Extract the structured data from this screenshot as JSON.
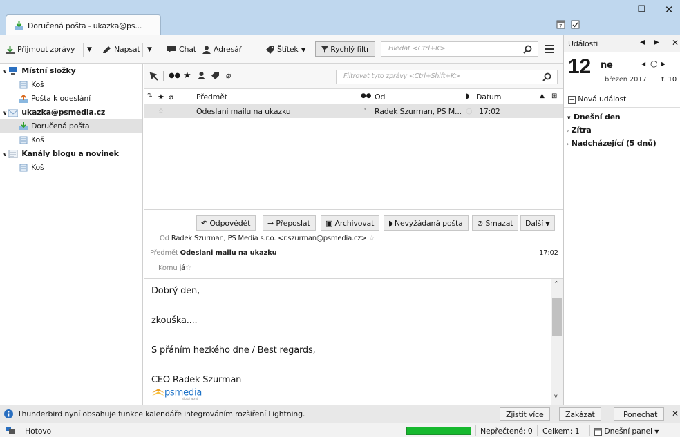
{
  "tab": {
    "title": "Doručená pošta - ukazka@ps..."
  },
  "toolbar": {
    "get_mail": "Přijmout zprávy",
    "write": "Napsat",
    "chat": "Chat",
    "address_book": "Adresář",
    "tag": "Štítek",
    "quick_filter": "Rychlý filtr",
    "search_placeholder": "Hledat <Ctrl+K>"
  },
  "folders": [
    {
      "label": "Místní složky",
      "bold": true
    },
    {
      "label": "Koš"
    },
    {
      "label": "Pošta k odeslání"
    },
    {
      "label": "ukazka@psmedia.cz",
      "bold": true
    },
    {
      "label": "Doručená pošta",
      "selected": true
    },
    {
      "label": "Koš"
    },
    {
      "label": "Kanály blogu a novinek",
      "bold": true
    },
    {
      "label": "Koš"
    }
  ],
  "thread": {
    "filter_placeholder": "Filtrovat tyto zprávy <Ctrl+Shift+K>",
    "columns": {
      "subject": "Předmět",
      "from": "Od",
      "date": "Datum"
    },
    "row": {
      "subject": "Odeslani mailu na ukazku",
      "from": "Radek Szurman, PS M...",
      "date": "17:02"
    }
  },
  "actions": {
    "reply": "Odpovědět",
    "forward": "Přeposlat",
    "archive": "Archivovat",
    "junk": "Nevyžádaná pošta",
    "delete": "Smazat",
    "more": "Další"
  },
  "header": {
    "from_label": "Od",
    "from_value": "Radek Szurman, PS Media s.r.o. <r.szurman@psmedia.cz>",
    "subject_label": "Předmět",
    "subject_value": "Odeslani mailu na ukazku",
    "time": "17:02",
    "to_label": "Komu",
    "to_value": "já"
  },
  "body": {
    "line1": "Dobrý den,",
    "line2": "zkouška....",
    "line3": "S přáním hezkého dne / Best regards,",
    "line4": "CEO Radek Szurman",
    "logo_text": "psmedia",
    "logo_sub": "digital world"
  },
  "lightning": {
    "title": "Události",
    "day": "12",
    "weekday": "ne",
    "month_year": "březen 2017",
    "week": "t. 10",
    "new_event": "Nová událost",
    "groups": [
      "Dnešní den",
      "Zítra",
      "Nadcházející (5 dnů)"
    ]
  },
  "notification": {
    "text": "Thunderbird nyní obsahuje funkce kalendáře integrováním rozšíření Lightning.",
    "btn_more": "Zjistit více",
    "btn_disable": "Zakázat",
    "btn_keep": "Ponechat"
  },
  "status": {
    "done": "Hotovo",
    "unread": "Nepřečtené: 0",
    "total": "Celkem: 1",
    "today_pane": "Dnešní panel"
  },
  "colors": {
    "accent": "#3b7bbf",
    "titlebar": "#bfd7ee",
    "progress": "#16b82e"
  }
}
